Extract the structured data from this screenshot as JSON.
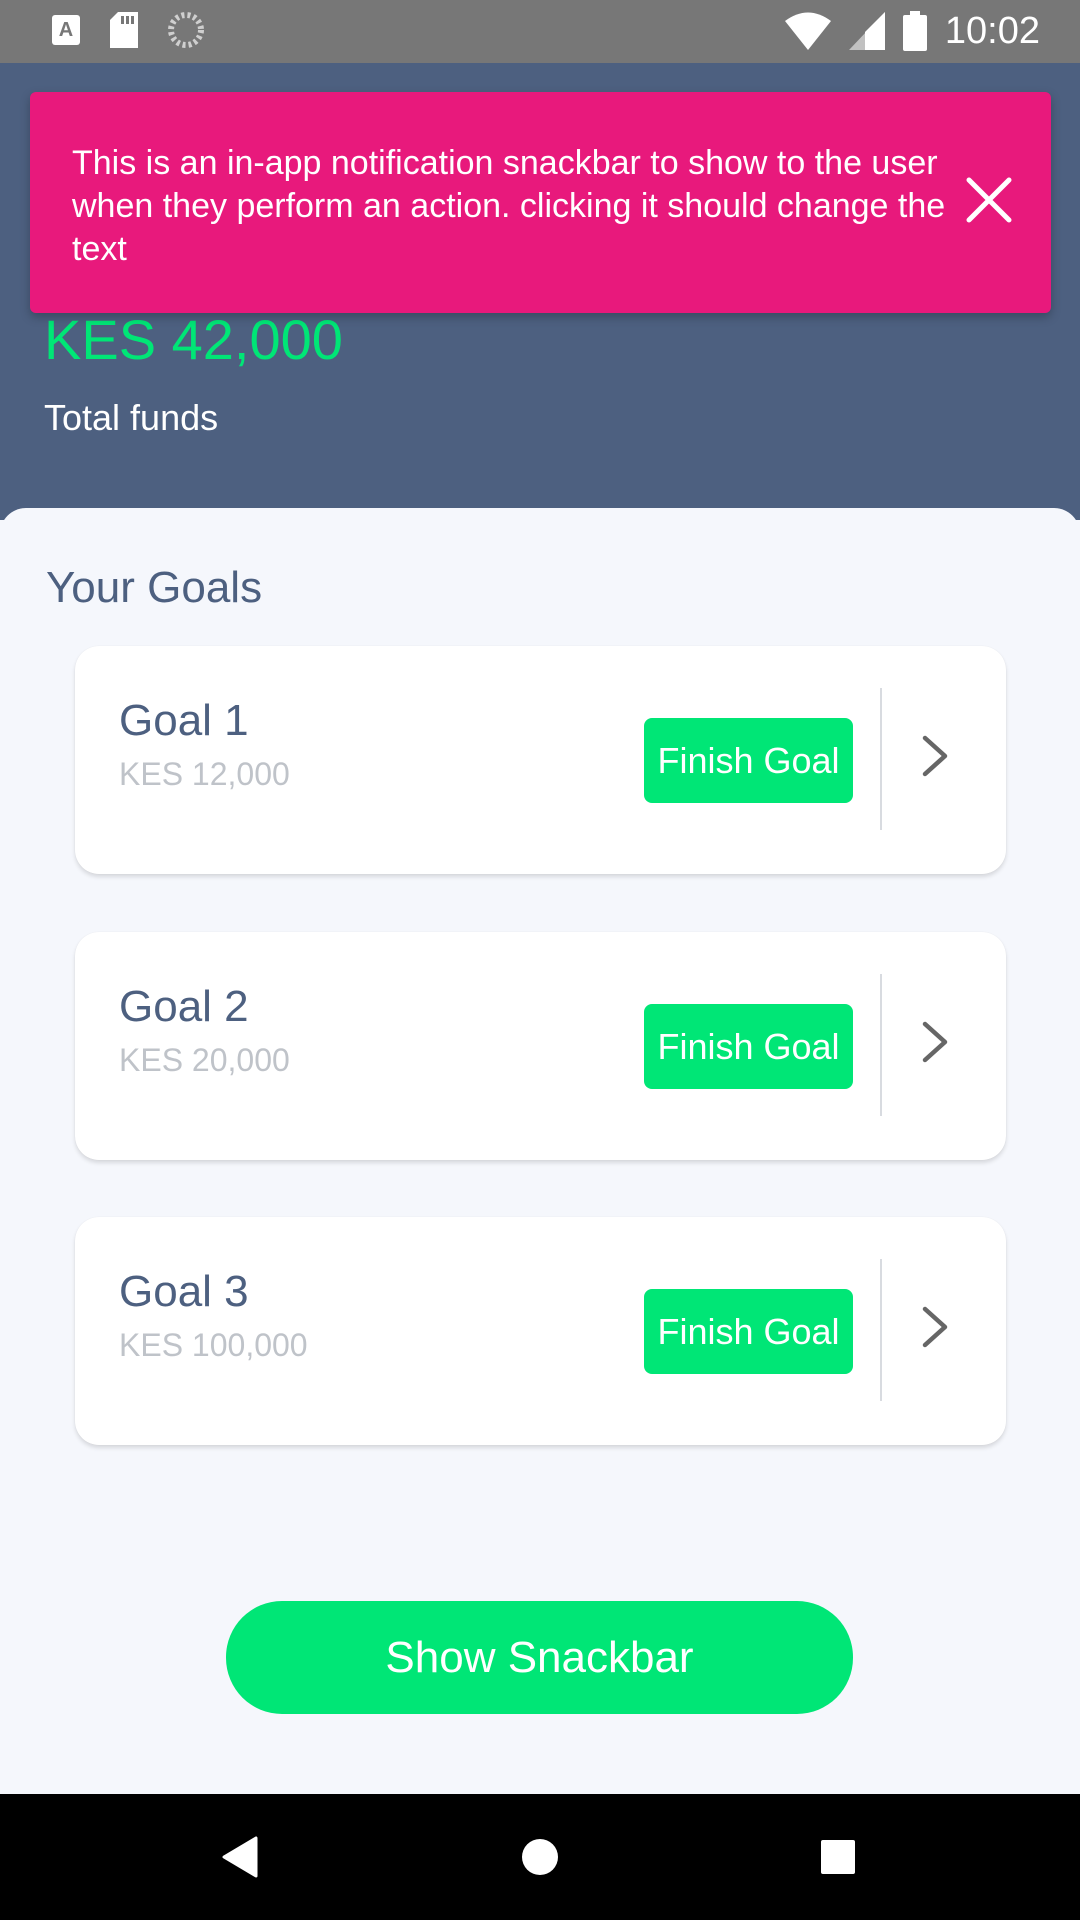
{
  "status_bar": {
    "time": "10:02",
    "left_icons": [
      "keyboard-icon",
      "sd-card-icon",
      "sync-icon"
    ],
    "right_icons": [
      "wifi-icon",
      "signal-icon",
      "battery-icon"
    ]
  },
  "header": {
    "balance": "KES 42,000",
    "balance_label": "Total funds",
    "background_color": "#4d6080",
    "balance_color": "#00e676"
  },
  "snackbar": {
    "text": "This is an in-app notification snackbar to show to the user when they perform an action. clicking it should change the text",
    "close_icon": "close-icon",
    "color": "#e8197c"
  },
  "goals_section": {
    "title": "Your Goals",
    "goals": [
      {
        "name": "Goal 1",
        "amount": "KES 12,000",
        "button_label": "Finish Goal"
      },
      {
        "name": "Goal 2",
        "amount": "KES 20,000",
        "button_label": "Finish Goal"
      },
      {
        "name": "Goal 3",
        "amount": "KES 100,000",
        "button_label": "Finish Goal"
      }
    ]
  },
  "show_snackbar_button": {
    "label": "Show Snackbar"
  },
  "nav_bar": {
    "buttons": [
      "back-icon",
      "home-icon",
      "recents-icon"
    ]
  },
  "colors": {
    "accent": "#00e676",
    "text_primary": "#4d6080",
    "text_muted": "#bfc3c9"
  }
}
